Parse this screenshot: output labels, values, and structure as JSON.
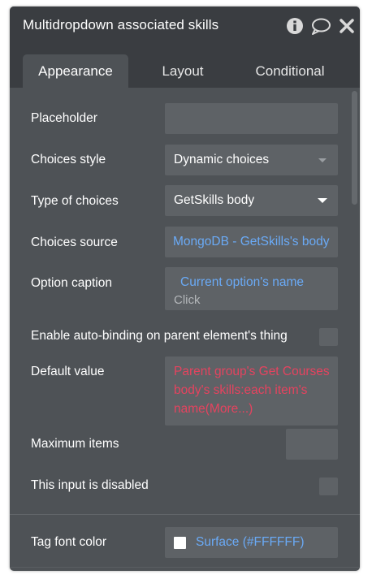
{
  "header": {
    "title": "Multidropdown associated skills",
    "icons": [
      "info-icon",
      "comment-icon",
      "close-icon"
    ]
  },
  "tabs": [
    {
      "label": "Appearance",
      "active": true
    },
    {
      "label": "Layout",
      "active": false
    },
    {
      "label": "Conditional",
      "active": false
    }
  ],
  "colors": {
    "link_blue": "#6aaaf6",
    "dynamic_red": "#e5435f",
    "header_bg": "#3a3d41",
    "panel_bg": "#4e5256",
    "field_bg": "#5e6266"
  },
  "fields": {
    "placeholder": {
      "label": "Placeholder",
      "value": ""
    },
    "choices_style": {
      "label": "Choices style",
      "value": "Dynamic choices"
    },
    "type_of_choices": {
      "label": "Type of choices",
      "value": "GetSkills body"
    },
    "choices_source": {
      "label": "Choices source",
      "value": "MongoDB - GetSkills's body"
    },
    "option_caption": {
      "label": "Option caption",
      "value": "Current option's name",
      "hint": "Click"
    },
    "auto_binding": {
      "label": "Enable auto-binding on parent element's thing",
      "checked": false
    },
    "default_value": {
      "label": "Default value",
      "value_lines": [
        "Parent group's Get Courses",
        "body's skills:each item's",
        "name(More...)"
      ]
    },
    "maximum_items": {
      "label": "Maximum items",
      "value": ""
    },
    "input_disabled": {
      "label": "This input is disabled",
      "checked": false
    },
    "tag_font_color": {
      "label": "Tag font color",
      "value": "Surface (#FFFFFF)",
      "swatch": "#ffffff"
    }
  }
}
